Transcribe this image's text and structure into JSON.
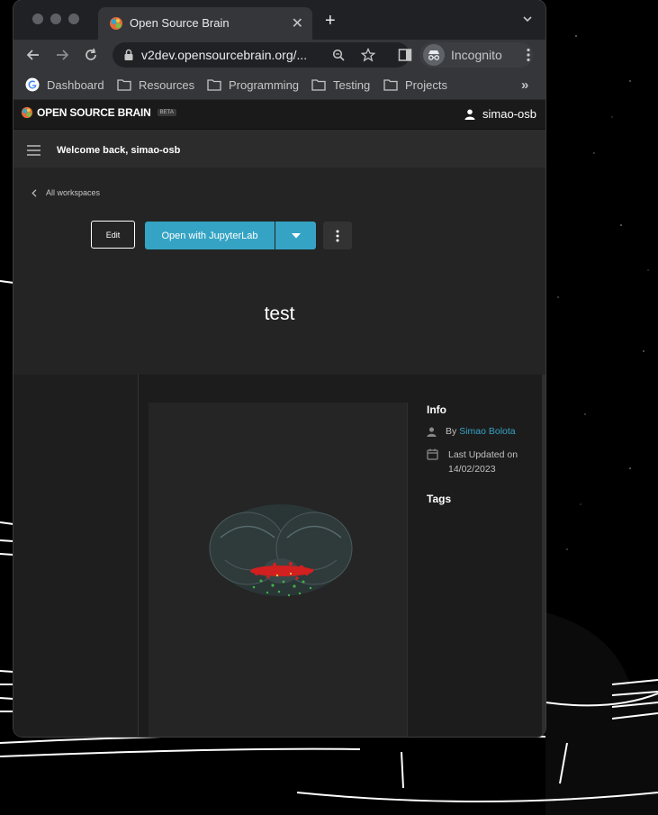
{
  "browser": {
    "tab": {
      "title": "Open Source Brain"
    },
    "url": "v2dev.opensourcebrain.org/...",
    "profile_label": "Incognito",
    "bookmarks": [
      {
        "label": "Dashboard",
        "icon": "google-icon"
      },
      {
        "label": "Resources",
        "icon": "folder-icon"
      },
      {
        "label": "Programming",
        "icon": "folder-icon"
      },
      {
        "label": "Testing",
        "icon": "folder-icon"
      },
      {
        "label": "Projects",
        "icon": "folder-icon"
      }
    ],
    "bookmarks_overflow": "»"
  },
  "app": {
    "brand": "OPEN SOURCE BRAIN",
    "beta_badge": "BETA",
    "user": "simao-osb",
    "welcome": "Welcome back, simao-osb",
    "back_link": "All workspaces",
    "actions": {
      "edit": "Edit",
      "open": "Open with JupyterLab"
    },
    "workspace_title": "test",
    "info": {
      "heading": "Info",
      "by_prefix": "By",
      "author": "Simao Bolota",
      "updated_label": "Last Updated on",
      "updated_date": "14/02/2023",
      "tags_heading": "Tags"
    }
  },
  "colors": {
    "accent": "#35a4c4",
    "app_bg": "#242424",
    "header_bg": "#1a1a1a"
  }
}
